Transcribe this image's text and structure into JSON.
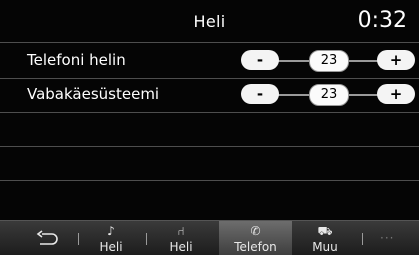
{
  "header": {
    "title": "Heli",
    "clock": "0:32"
  },
  "rows": [
    {
      "label": "Telefoni helin",
      "minus": "-",
      "value": "23",
      "plus": "+"
    },
    {
      "label": "Vabakäesüsteemi",
      "minus": "-",
      "value": "23",
      "plus": "+"
    }
  ],
  "nav": {
    "back_icon": "back-arrow-icon",
    "tabs": [
      {
        "label": "Heli",
        "icon": "music-note-icon",
        "glyph": "♪",
        "active": false
      },
      {
        "label": "Heli",
        "icon": "seat-icon",
        "glyph": "⑁",
        "active": false
      },
      {
        "label": "Telefon",
        "icon": "phone-icon",
        "glyph": "✆",
        "active": true
      },
      {
        "label": "Muu",
        "icon": "car-icon",
        "glyph": "⛟",
        "active": false
      }
    ],
    "more": "···"
  },
  "colors": {
    "background": "#050505",
    "pill": "#f4f4f4",
    "active_tab": "#5a5a5a"
  }
}
